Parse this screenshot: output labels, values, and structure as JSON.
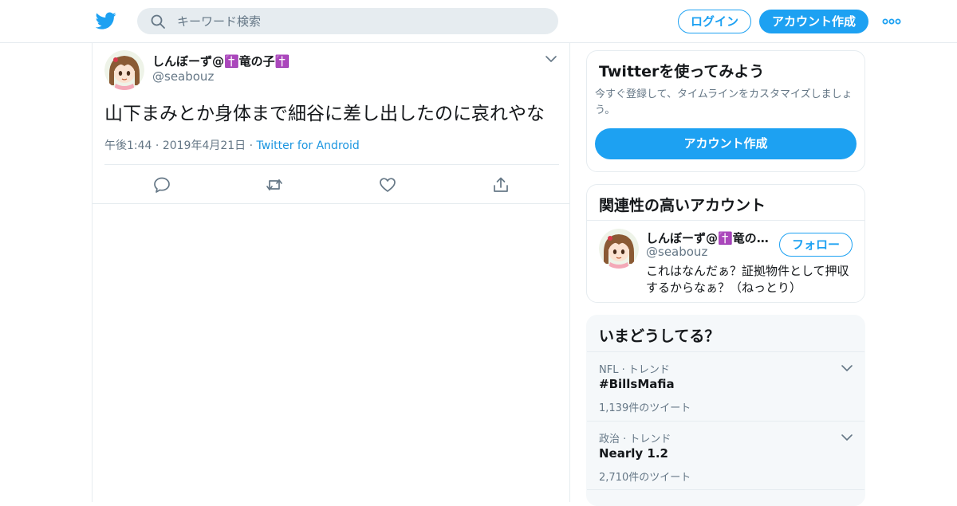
{
  "topbar": {
    "search_placeholder": "キーワード検索",
    "login_label": "ログイン",
    "signup_label": "アカウント作成"
  },
  "tweet": {
    "display_name": "しんぼーず@✝️竜の子✝️",
    "handle": "@seabouz",
    "text": "山下まみとか身体まで細谷に差し出したのに哀れやな",
    "time": "午後1:44",
    "date": "2019年4月21日",
    "source": "Twitter for Android"
  },
  "signup_card": {
    "title": "Twitterを使ってみよう",
    "description": "今すぐ登録して、タイムラインをカスタマイズしましょう。",
    "button_label": "アカウント作成"
  },
  "related_card": {
    "title": "関連性の高いアカウント",
    "account": {
      "display_name": "しんぼーず@✝️竜の子✝️",
      "handle": "@seabouz",
      "bio": "これはなんだぁ？証拠物件として押収するからなぁ？（ねっとり）",
      "follow_label": "フォロー"
    }
  },
  "trends_card": {
    "title": "いまどうしてる？",
    "trends": [
      {
        "category": "NFL · トレンド",
        "title": "#BillsMafia",
        "count": "1,139件のツイート"
      },
      {
        "category": "政治 · トレンド",
        "title": "Nearly 1.2",
        "count": "2,710件のツイート"
      }
    ]
  },
  "colors": {
    "accent": "#1da1f2",
    "text_primary": "#14171a",
    "text_secondary": "#657786",
    "border": "#e6ecf0",
    "link": "#1b95e0"
  },
  "icons": {
    "logo": "twitter-bird-icon",
    "search": "search-icon",
    "more": "more-dots-icon",
    "caret": "chevron-down-icon",
    "reply": "reply-icon",
    "retweet": "retweet-icon",
    "like": "heart-icon",
    "share": "share-icon"
  }
}
